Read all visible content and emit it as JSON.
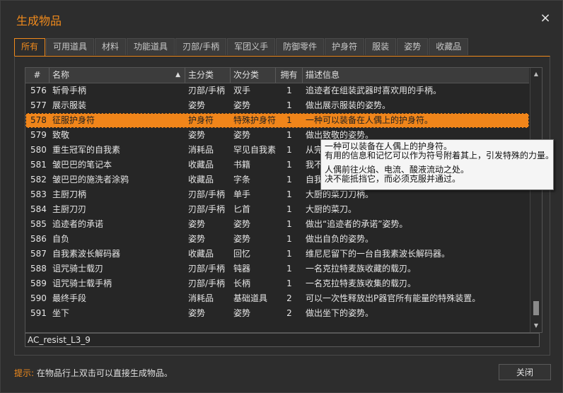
{
  "window": {
    "title": "生成物品",
    "close_glyph": "×"
  },
  "tabs": [
    {
      "label": "所有",
      "active": true
    },
    {
      "label": "可用道具"
    },
    {
      "label": "材料"
    },
    {
      "label": "功能道具"
    },
    {
      "label": "刃部/手柄"
    },
    {
      "label": "军团义手"
    },
    {
      "label": "防御零件"
    },
    {
      "label": "护身符"
    },
    {
      "label": "服装"
    },
    {
      "label": "姿势"
    },
    {
      "label": "收藏品"
    }
  ],
  "table": {
    "headers": {
      "num": "#",
      "name": "名称",
      "main_cat": "主分类",
      "sub_cat": "次分类",
      "owned": "拥有",
      "desc": "描述信息"
    },
    "sort_indicator": "▲",
    "rows": [
      {
        "num": "576",
        "name": "斩骨手柄",
        "main_cat": "刃部/手柄",
        "sub_cat": "双手",
        "owned": "1",
        "desc": "追迹者在组装武器时喜欢用的手柄。"
      },
      {
        "num": "577",
        "name": "展示服装",
        "main_cat": "姿势",
        "sub_cat": "姿势",
        "owned": "1",
        "desc": "做出展示服装的姿势。"
      },
      {
        "num": "578",
        "name": "征服护身符",
        "main_cat": "护身符",
        "sub_cat": "特殊护身符",
        "owned": "1",
        "desc": "一种可以装备在人偶上的护身符。",
        "selected": true
      },
      {
        "num": "579",
        "name": "致敬",
        "main_cat": "姿势",
        "sub_cat": "姿势",
        "owned": "1",
        "desc": "做出致敬的姿势。"
      },
      {
        "num": "580",
        "name": "重生冠军的自我素",
        "main_cat": "消耗品",
        "sub_cat": "罕见自我素",
        "owned": "1",
        "desc": "从完成后的梦中获得的力量。"
      },
      {
        "num": "581",
        "name": "皱巴巴的笔记本",
        "main_cat": "收藏品",
        "sub_cat": "书籍",
        "owned": "1",
        "desc": "我不知道你在说什么。"
      },
      {
        "num": "582",
        "name": "皱巴巴的施洗者涂鸦",
        "main_cat": "收藏品",
        "sub_cat": "字条",
        "owned": "1",
        "desc": "自我素施洗者的涂鸦。"
      },
      {
        "num": "583",
        "name": "主厨刀柄",
        "main_cat": "刃部/手柄",
        "sub_cat": "单手",
        "owned": "1",
        "desc": "大厨的菜刀刀柄。"
      },
      {
        "num": "584",
        "name": "主厨刀刃",
        "main_cat": "刃部/手柄",
        "sub_cat": "匕首",
        "owned": "1",
        "desc": "大厨的菜刀。"
      },
      {
        "num": "585",
        "name": "追迹者的承诺",
        "main_cat": "姿势",
        "sub_cat": "姿势",
        "owned": "1",
        "desc": "做出“追迹者的承诺”姿势。"
      },
      {
        "num": "586",
        "name": "自负",
        "main_cat": "姿势",
        "sub_cat": "姿势",
        "owned": "1",
        "desc": "做出自负的姿势。"
      },
      {
        "num": "587",
        "name": "自我素波长解码器",
        "main_cat": "收藏品",
        "sub_cat": "回忆",
        "owned": "1",
        "desc": "维尼尼留下的一台自我素波长解码器。"
      },
      {
        "num": "588",
        "name": "诅咒骑士载刃",
        "main_cat": "刃部/手柄",
        "sub_cat": "钝器",
        "owned": "1",
        "desc": "一名克拉特麦族收藏的载刃。"
      },
      {
        "num": "589",
        "name": "诅咒骑士载手柄",
        "main_cat": "刃部/手柄",
        "sub_cat": "长柄",
        "owned": "1",
        "desc": "一名克拉特麦族收集的载刃。"
      },
      {
        "num": "590",
        "name": "最终手段",
        "main_cat": "消耗品",
        "sub_cat": "基础道具",
        "owned": "2",
        "desc": "可以一次性释放出P器官所有能量的特殊装置。"
      },
      {
        "num": "591",
        "name": "坐下",
        "main_cat": "姿势",
        "sub_cat": "姿势",
        "owned": "2",
        "desc": "做出坐下的姿势。"
      }
    ]
  },
  "tooltip": {
    "line1": "一种可以装备在人偶上的护身符。",
    "line2": "有用的信息和记忆可以作为符号附着其上，引发特殊的力量。",
    "line3": "人偶前往火焰、电流、酸液流动之处。",
    "line4": "决不能抵挡它，而必须克服并通过。"
  },
  "search": {
    "value": "AC_resist_L3_9"
  },
  "footer": {
    "hint_label": "提示:",
    "hint_text": "在物品行上双击可以直接生成物品。",
    "close_label": "关闭"
  },
  "colors": {
    "accent": "#f08a1c",
    "background": "#2d2d2d"
  }
}
